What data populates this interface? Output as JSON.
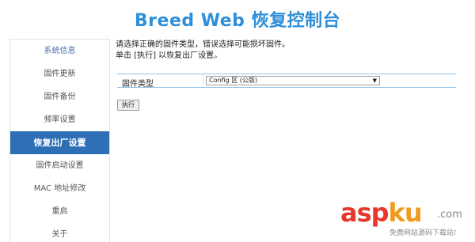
{
  "header": {
    "title": "Breed Web 恢复控制台"
  },
  "sidebar": {
    "items": [
      {
        "label": "系统信息"
      },
      {
        "label": "固件更新"
      },
      {
        "label": "固件备份"
      },
      {
        "label": "频率设置"
      },
      {
        "label": "恢复出厂设置"
      },
      {
        "label": "固件启动设置"
      },
      {
        "label": "MAC 地址修改"
      },
      {
        "label": "重启"
      },
      {
        "label": "关于"
      }
    ],
    "active_index": 4
  },
  "main": {
    "description_line1": "请选择正确的固件类型，错误选择可能损坏固件。",
    "description_line2": "单击 [执行] 以恢复出厂设置。",
    "firmware_type_label": "固件类型",
    "firmware_type_value": "Config 区 (公版)",
    "execute_label": "执行"
  },
  "watermark": {
    "brand_asp": "asp",
    "brand_ku": "ku",
    "domain": ".com",
    "subtitle": "免费网站源码下载站!"
  },
  "colors": {
    "title": "#2f8fd8",
    "active_item": "#2e6fb6",
    "table_border": "#8fc3e8"
  },
  "icons": {
    "select_caret": "chevron-down-icon"
  }
}
